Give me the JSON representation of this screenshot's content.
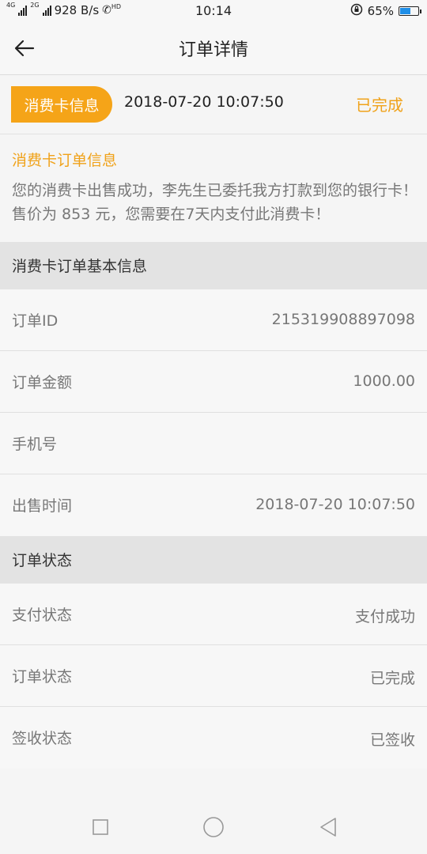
{
  "status_bar": {
    "net_4g": "4G",
    "net_2g": "2G",
    "speed": "928 B/s",
    "hd": "HD",
    "time": "10:14",
    "battery": "65%",
    "battery_level": 0.65,
    "battery_color": "#1f8fe8"
  },
  "header": {
    "title": "订单详情",
    "back_icon": "back-arrow-icon"
  },
  "info_bar": {
    "tag": "消费卡信息",
    "time": "2018-07-20 10:07:50",
    "status": "已完成",
    "accent_color": "#f5a418"
  },
  "notice": {
    "title": "消费卡订单信息",
    "text": "您的消费卡出售成功，李先生已委托我方打款到您的银行卡！售价为 853 元，您需要在7天内支付此消费卡！"
  },
  "basic_section": {
    "title": "消费卡订单基本信息",
    "rows": [
      {
        "label": "订单ID",
        "value": "215319908897098"
      },
      {
        "label": "订单金额",
        "value": "1000.00"
      },
      {
        "label": "手机号",
        "value": ""
      },
      {
        "label": "出售时间",
        "value": "2018-07-20 10:07:50"
      }
    ]
  },
  "status_section": {
    "title": "订单状态",
    "rows": [
      {
        "label": "支付状态",
        "value": "支付成功"
      },
      {
        "label": "订单状态",
        "value": "已完成"
      },
      {
        "label": "签收状态",
        "value": "已签收"
      }
    ]
  },
  "nav_bar": {
    "recent_icon": "square-icon",
    "home_icon": "circle-icon",
    "back_icon": "triangle-back-icon"
  }
}
